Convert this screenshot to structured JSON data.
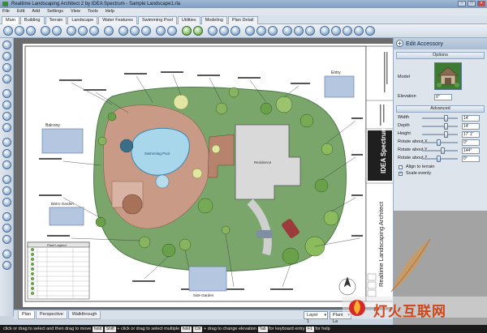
{
  "window": {
    "title": "Realtime Landscaping Architect 2 by IDEA Spectrum - Sample Landscape1.rla"
  },
  "menu": [
    "File",
    "Edit",
    "Add",
    "Settings",
    "View",
    "Tools",
    "Help"
  ],
  "mode_tabs": [
    {
      "label": "Main",
      "active": true
    },
    {
      "label": "Building"
    },
    {
      "label": "Terrain"
    },
    {
      "label": "Landscape"
    },
    {
      "label": "Water Features"
    },
    {
      "label": "Swimming Pool"
    },
    {
      "label": "Utilities"
    },
    {
      "label": "Modeling"
    },
    {
      "label": "Plan Detail"
    }
  ],
  "view_tabs": [
    {
      "label": "Plan",
      "active": true
    },
    {
      "label": "Perspective"
    },
    {
      "label": "Walkthrough"
    }
  ],
  "layer_select": {
    "value": "Layer 1"
  },
  "plant_layer_select": {
    "value": "Plant La"
  },
  "plan": {
    "labels": [
      "Balcony",
      "Swimming Pool",
      "Residence",
      "Entry",
      "Bistro Garden",
      "Side Garden",
      "Plant Legend"
    ],
    "sidebar_text": {
      "brand": "IDEA Spectrum",
      "product": "Realtime Landscaping Architect"
    }
  },
  "panel": {
    "title": "Edit Accessory",
    "sections": {
      "options": "Options",
      "advanced": "Advanced"
    },
    "model_label": "Model",
    "elevation": {
      "label": "Elevation",
      "value": "0\""
    },
    "properties": [
      {
        "label": "Width",
        "value": "14'",
        "level": 0.7
      },
      {
        "label": "Depth",
        "value": "14'",
        "level": 0.7
      },
      {
        "label": "Height",
        "value": "17' 1\"",
        "level": 0.7
      },
      {
        "label": "Rotate about X",
        "value": "0°",
        "level": 0.45
      },
      {
        "label": "Rotate about Y",
        "value": "144°",
        "level": 0.6
      },
      {
        "label": "Rotate about Z",
        "value": "0°",
        "level": 0.45
      }
    ],
    "checks": [
      {
        "label": "Align to terrain",
        "checked": false
      },
      {
        "label": "Scale evenly",
        "checked": true
      }
    ]
  },
  "status": {
    "parts": [
      {
        "key": "",
        "text": "click or drag to select and then drag to move"
      },
      {
        "key": "hold",
        "text": ""
      },
      {
        "key": "Shift",
        "text": "+ click or drag to select multiple"
      },
      {
        "key": "hold",
        "text": ""
      },
      {
        "key": "Ctrl",
        "text": "+ drag to change elevation"
      },
      {
        "key": "Tab",
        "text": "for keyboard entry"
      },
      {
        "key": "F1",
        "text": "for help"
      }
    ]
  },
  "watermark": {
    "text": "灯火互联网"
  }
}
